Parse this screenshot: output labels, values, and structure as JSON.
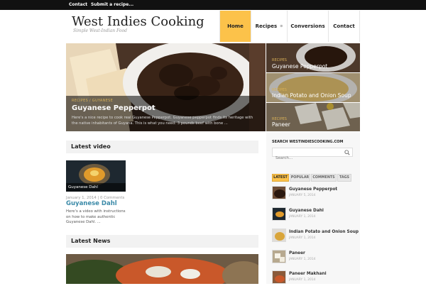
{
  "topbar": {
    "links": [
      "Contact",
      "Submit a recipe..."
    ]
  },
  "header": {
    "title": "West Indies Cooking",
    "tagline": "Simple West-Indian Food"
  },
  "nav": [
    {
      "label": "Home",
      "active": true
    },
    {
      "label": "Recipes",
      "active": false,
      "has_dropdown": true
    },
    {
      "label": "Conversions",
      "active": false
    },
    {
      "label": "Contact",
      "active": false
    }
  ],
  "slider": {
    "category": "Recipes / Guyanese",
    "title": "Guyanese Pepperpot",
    "excerpt": "Here's a nice recipe to cook real Guyanese Pepperpot. Guyanese pepperpot finds its heritage with the native inhabitants of Guyana. This is what you need: 3 pounds beef with bone ..."
  },
  "featured": [
    {
      "category": "Recipes",
      "title": "Guyanese Pepperpot"
    },
    {
      "category": "Recipes",
      "title": "Indian Potato and Onion Soup"
    },
    {
      "category": "Recipes",
      "title": "Paneer"
    }
  ],
  "latest_video": {
    "heading": "Latest video",
    "thumb_caption": "Guyanese Dahl",
    "meta": "January 1, 2014 | 0 Comments",
    "title": "Guyanese Dahl",
    "excerpt": "Here's a video with instructions on how to make authentic Guyanese Dahl. ..."
  },
  "latest_news": {
    "heading": "Latest News"
  },
  "sidebar": {
    "search_heading": "Search westindiescooking.com",
    "search_placeholder": "Search...",
    "tabs": [
      "Latest",
      "Popular",
      "Comments",
      "Tags"
    ],
    "posts": [
      {
        "title": "Guyanese Pepperpot",
        "date": "January 5, 2014"
      },
      {
        "title": "Guyanese Dahl",
        "date": "January 1, 2014"
      },
      {
        "title": "Indian Potato and Onion Soup",
        "date": "January 1, 2014"
      },
      {
        "title": "Paneer",
        "date": "January 1, 2014"
      },
      {
        "title": "Paneer Makhani",
        "date": "January 1, 2014"
      }
    ]
  },
  "colors": {
    "accent": "#fcc24a",
    "link": "#3b8aa8",
    "category": "#d8b056"
  }
}
